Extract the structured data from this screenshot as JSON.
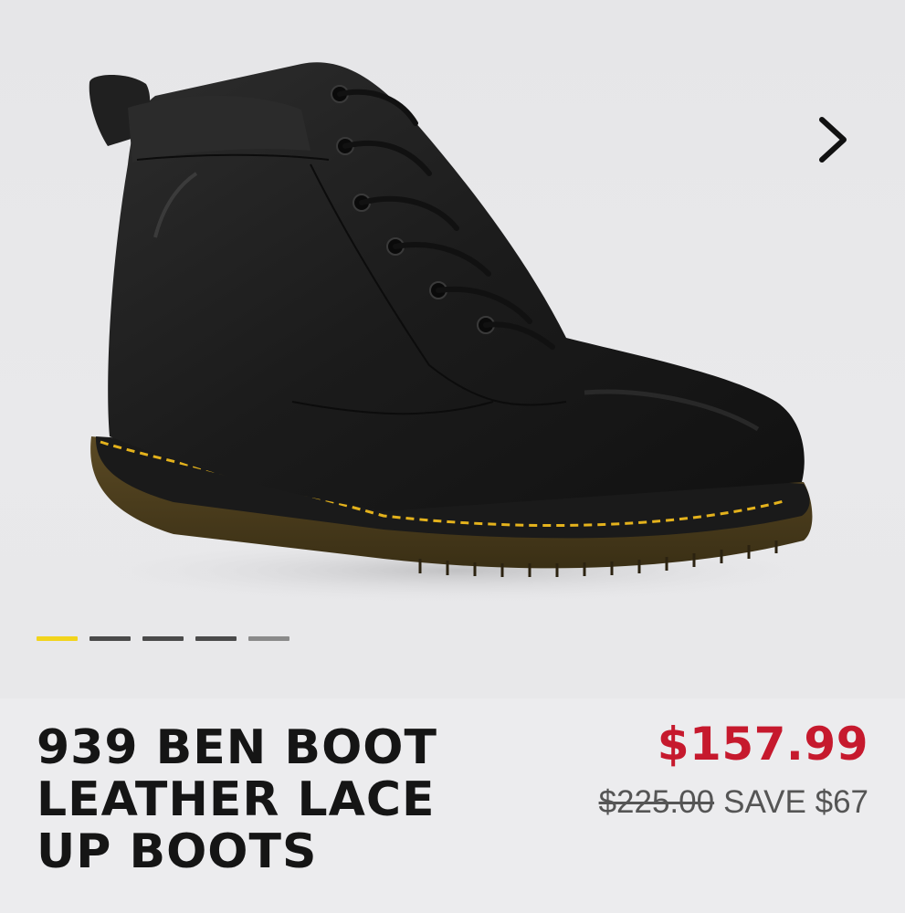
{
  "product": {
    "title_lines": [
      "939 BEN BOOT",
      "LEATHER LACE",
      "UP BOOTS"
    ],
    "price": "$157.99",
    "original_price": "$225.00",
    "savings": "SAVE $67"
  },
  "gallery": {
    "image_count": 5,
    "active_index": 0,
    "next_icon": "chevron-right-icon"
  },
  "colors": {
    "price_accent": "#c6192d",
    "active_indicator": "#f2d41c",
    "stitch": "#e4b21c"
  }
}
